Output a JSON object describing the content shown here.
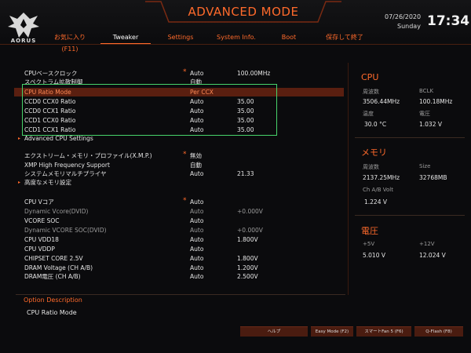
{
  "header": {
    "title": "ADVANCED MODE",
    "date": "07/26/2020",
    "day": "Sunday",
    "time": "17:34",
    "logo_text": "AORUS"
  },
  "tabs": [
    {
      "label": "お気に入り (F11)"
    },
    {
      "label": "Tweaker"
    },
    {
      "label": "Settings"
    },
    {
      "label": "System Info."
    },
    {
      "label": "Boot"
    },
    {
      "label": "保存して終了"
    }
  ],
  "settings": [
    {
      "label": "CPUベースクロック",
      "star": "*",
      "v1": "Auto",
      "v2": "100.00MHz"
    },
    {
      "label": "スペクトラム拡散制御",
      "star": "",
      "v1": "自動",
      "v2": ""
    },
    {
      "label": "CPU Ratio Mode",
      "star": "",
      "v1": "Per CCX",
      "v2": ""
    },
    {
      "label": "CCD0 CCX0 Ratio",
      "star": "",
      "v1": "Auto",
      "v2": "35.00"
    },
    {
      "label": "CCD0 CCX1 Ratio",
      "star": "",
      "v1": "Auto",
      "v2": "35.00"
    },
    {
      "label": "CCD1 CCX0  Ratio",
      "star": "",
      "v1": "Auto",
      "v2": "35.00"
    },
    {
      "label": "CCD1 CCX1  Ratio",
      "star": "",
      "v1": "Auto",
      "v2": "35.00"
    },
    {
      "label": "Advanced CPU Settings",
      "star": "",
      "v1": "",
      "v2": ""
    },
    {
      "label": "エクストリーム・メモリ・プロファイル(X.M.P.)",
      "star": "*",
      "v1": "無効",
      "v2": ""
    },
    {
      "label": "XMP High Frequency Support",
      "star": "",
      "v1": "自動",
      "v2": ""
    },
    {
      "label": "システムメモリマルチプライヤ",
      "star": "",
      "v1": "Auto",
      "v2": "21.33"
    },
    {
      "label": "高度なメモリ設定",
      "star": "",
      "v1": "",
      "v2": ""
    },
    {
      "label": "CPU Vコア",
      "star": "*",
      "v1": "Auto",
      "v2": ""
    },
    {
      "label": "Dynamic Vcore(DVID)",
      "star": "",
      "v1": "Auto",
      "v2": "+0.000V"
    },
    {
      "label": "VCORE SOC",
      "star": "",
      "v1": "Auto",
      "v2": ""
    },
    {
      "label": "Dynamic VCORE SOC(DVID)",
      "star": "",
      "v1": "Auto",
      "v2": "+0.000V"
    },
    {
      "label": "CPU VDD18",
      "star": "",
      "v1": "Auto",
      "v2": "1.800V"
    },
    {
      "label": "CPU VDDP",
      "star": "",
      "v1": "Auto",
      "v2": ""
    },
    {
      "label": "CHIPSET CORE 2.5V",
      "star": "",
      "v1": "Auto",
      "v2": "1.800V"
    },
    {
      "label": "DRAM Voltage    (CH A/B)",
      "star": "",
      "v1": "Auto",
      "v2": "1.200V"
    },
    {
      "label": "DRAM電圧      (CH A/B)",
      "star": "",
      "v1": "Auto",
      "v2": "2.500V"
    }
  ],
  "side": {
    "cpu": {
      "title": "CPU",
      "freq_label": "周波数",
      "freq": "3506.44MHz",
      "bclk_label": "BCLK",
      "bclk": "100.18MHz",
      "temp_label": "温度",
      "temp": "30.0 °C",
      "volt_label": "電圧",
      "volt": "1.032 V"
    },
    "memory": {
      "title": "メモリ",
      "freq_label": "周波数",
      "freq": "2137.25MHz",
      "size_label": "Size",
      "size": "32768MB",
      "volt_label": "Ch A/B Volt",
      "volt": "1.224 V"
    },
    "voltage": {
      "title": "電圧",
      "v5_label": "+5V",
      "v5": "5.010 V",
      "v12_label": "+12V",
      "v12": "12.024 V"
    }
  },
  "description": {
    "title": "Option Description",
    "text": "CPU Ratio Mode"
  },
  "buttons": [
    {
      "label": "ヘルプ"
    },
    {
      "label": "Easy Mode (F2)"
    },
    {
      "label": "スマートFan 5 (F6)"
    },
    {
      "label": "Q-Flash (F8)"
    }
  ]
}
